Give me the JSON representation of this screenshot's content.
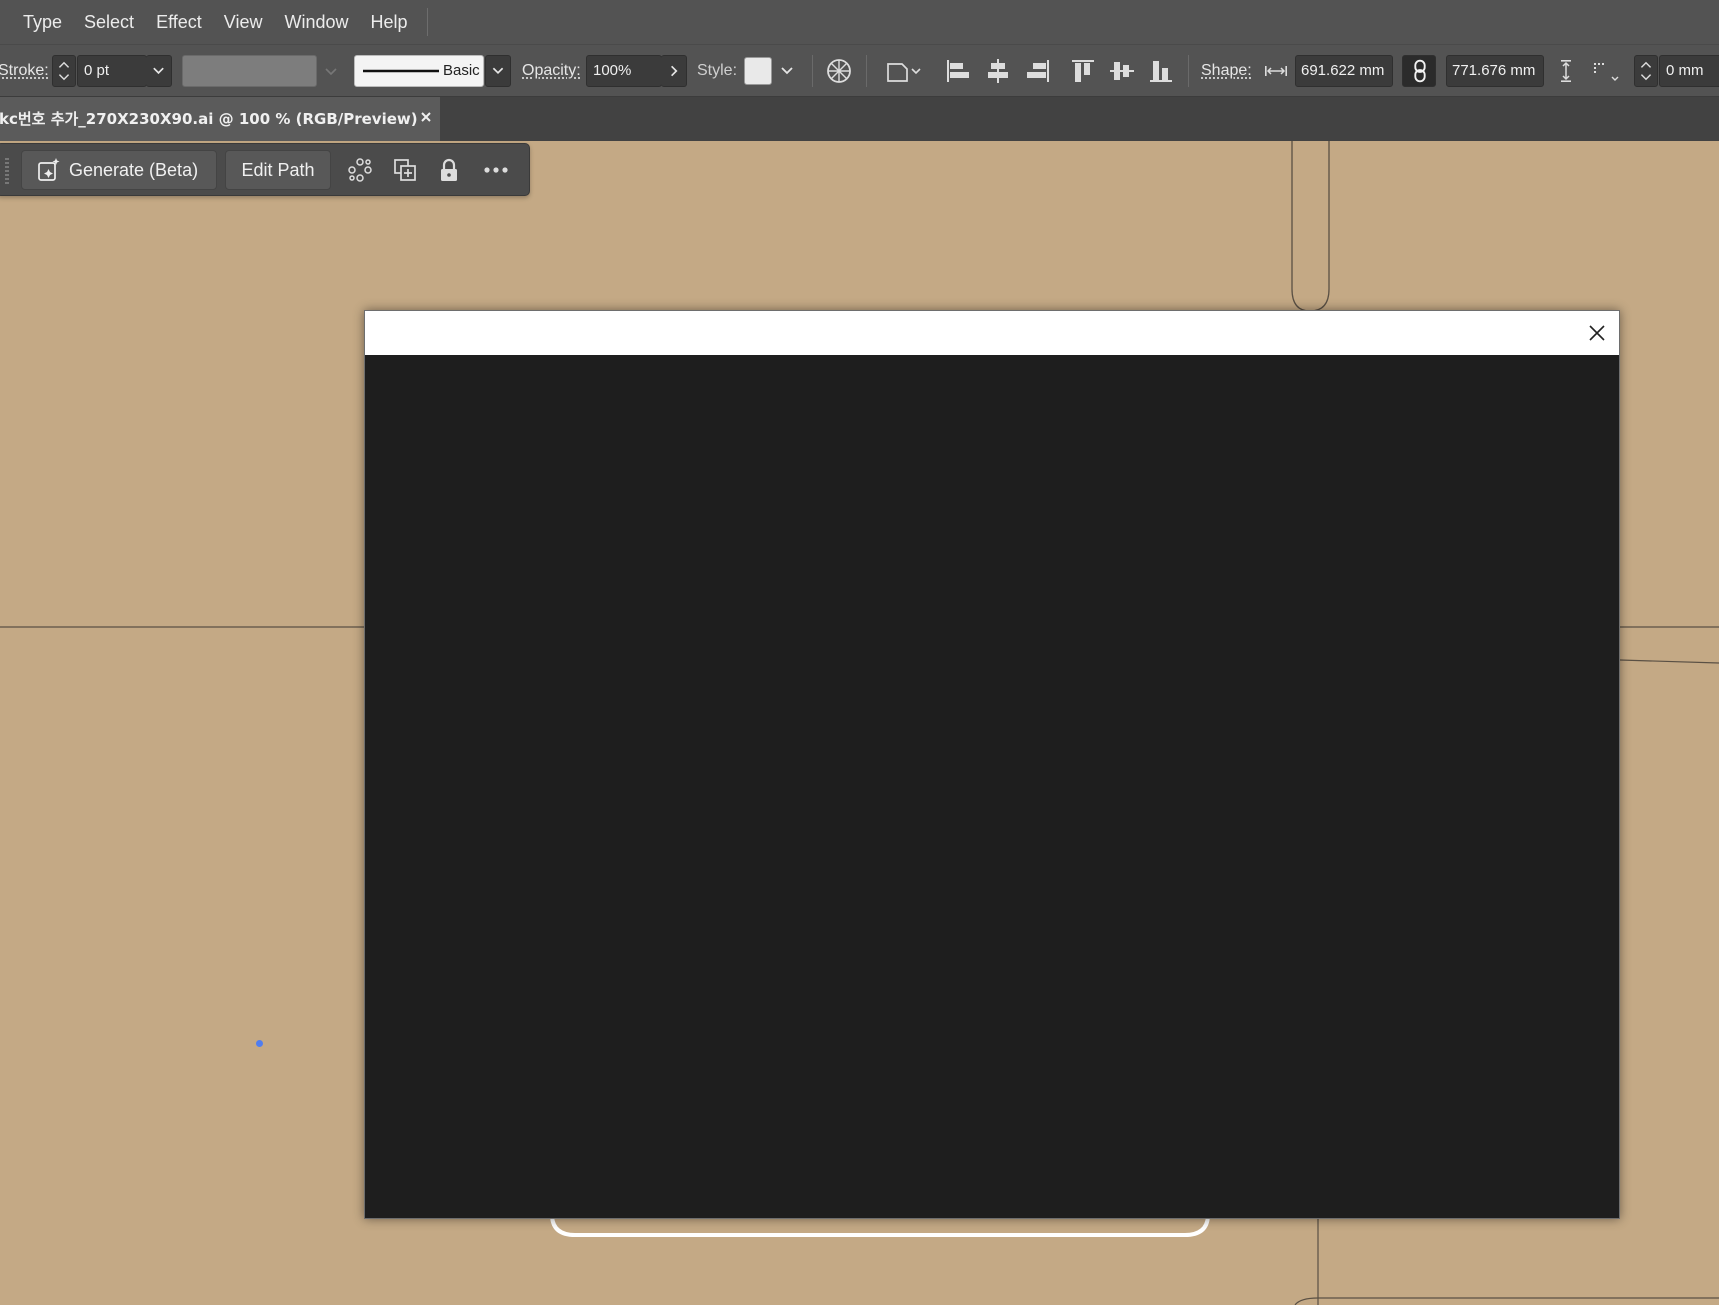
{
  "menubar": {
    "items": [
      "Type",
      "Select",
      "Effect",
      "View",
      "Window",
      "Help"
    ]
  },
  "controlbar": {
    "stroke_label": "Stroke:",
    "stroke_value": "0 pt",
    "brush_label": "Basic",
    "opacity_label": "Opacity:",
    "opacity_value": "100%",
    "style_label": "Style:",
    "shape_label": "Shape:",
    "width_value": "691.622 mm",
    "height_value": "771.676 mm",
    "corner_value": "0 mm"
  },
  "document_tab": {
    "title": "kc번호 추가_270X230X90.ai @ 100 % (RGB/Preview)"
  },
  "taskbar": {
    "generate_label": "Generate (Beta)",
    "edit_path_label": "Edit Path"
  },
  "colors": {
    "canvas": "#c4a985",
    "chrome": "#535353",
    "modal_body": "#1e1e1e",
    "modal_header": "#ffffff",
    "anchor": "#4f7df0"
  }
}
